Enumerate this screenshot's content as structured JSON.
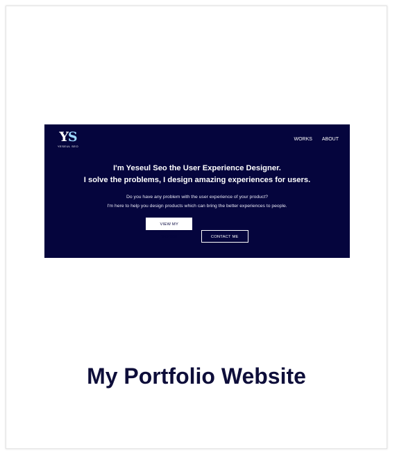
{
  "preview": {
    "logo": {
      "mark_y": "Y",
      "mark_s": "S",
      "sub": "YESEUL SEO"
    },
    "nav": [
      "WORKS",
      "ABOUT"
    ],
    "headline_line1": "I'm Yeseul Seo the User Experience Designer.",
    "headline_line2": "I solve the problems, I design amazing experiences for users.",
    "sub_line1": "Do you have any problem with the user experience of your product?",
    "sub_line2": "I'm here to help you design products which can bring the better experiences to people.",
    "primary_button": "VIEW MY WORKS",
    "secondary_button": "CONTACT ME",
    "background_color": "#05053d"
  },
  "card": {
    "title": "My Portfolio Website"
  }
}
